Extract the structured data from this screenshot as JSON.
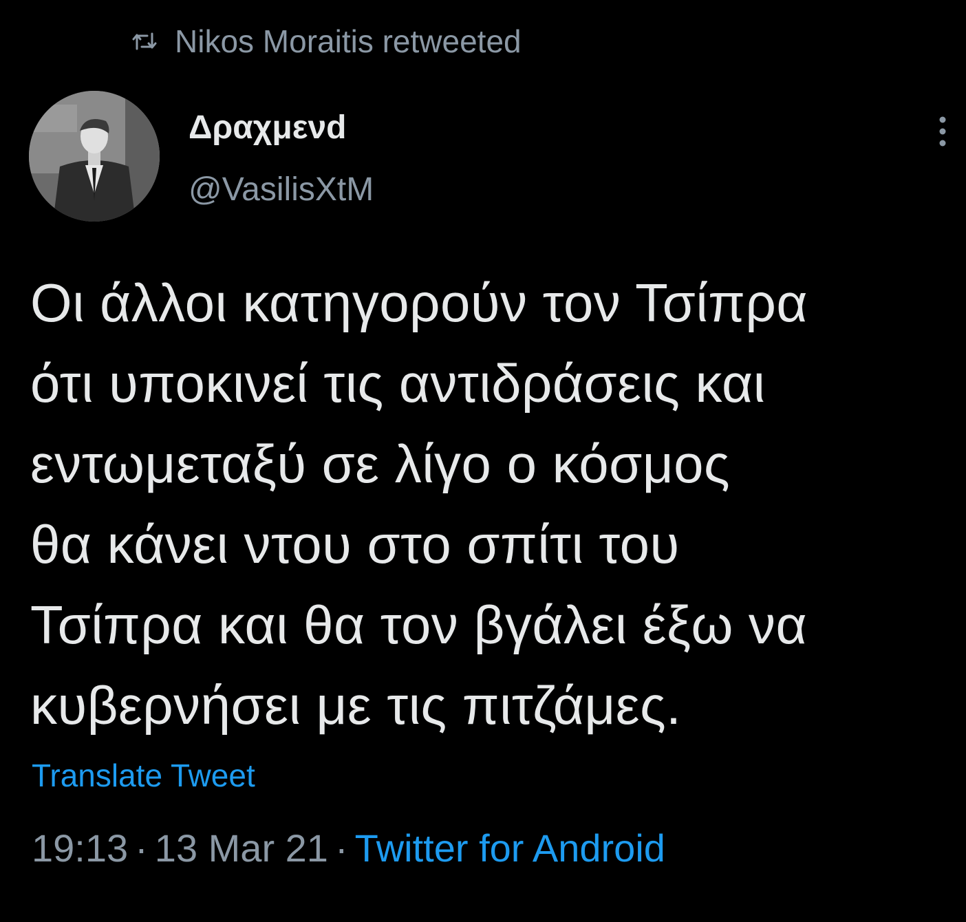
{
  "retweet": {
    "icon": "retweet-icon",
    "text": "Nikos Moraitis retweeted"
  },
  "author": {
    "avatar": "avatar",
    "display_name": "Δραχμενd",
    "handle": "@VasilisXtM"
  },
  "menu": {
    "icon": "more-vertical-icon"
  },
  "tweet": {
    "lines": [
      "Οι άλλοι κατηγορούν τον Τσίπρα",
      "ότι υποκινεί τις αντιδράσεις και",
      "εντωμεταξύ σε λίγο ο κόσμος",
      "θα κάνει ντου στο σπίτι του",
      "Τσίπρα και θα τον βγάλει έξω να",
      "κυβερνήσει με τις πιτζάμες."
    ]
  },
  "translate_label": "Translate Tweet",
  "meta": {
    "time": "19:13",
    "separator": "·",
    "date": "13 Mar 21",
    "source": "Twitter for Android"
  },
  "colors": {
    "background": "#000000",
    "text": "#e7e9ea",
    "secondary": "#8b98a5",
    "link": "#1d9bf0"
  }
}
